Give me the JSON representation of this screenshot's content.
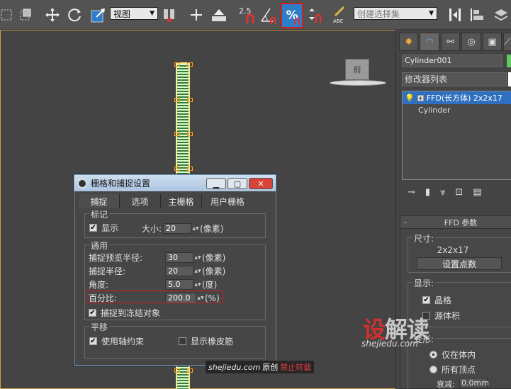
{
  "toolbar": {
    "view_dropdown": "视图",
    "snap_value": "2.5",
    "named_selection": "创建选择集"
  },
  "viewport": {
    "viewcube_label": "前"
  },
  "panel": {
    "object_name": "Cylinder001",
    "object_color": "#5ec95e",
    "modifier_list": "修改器列表",
    "stack": {
      "ffd": "FFD(长方体) 2x2x17",
      "cylinder": "Cylinder"
    },
    "ffd_params": {
      "title": "FFD 参数",
      "dimensions_group": "尺寸:",
      "dimensions_value": "2x2x17",
      "set_points_button": "设置点数",
      "display_group": "显示:",
      "lattice_label": "晶格",
      "source_volume_label": "源体积",
      "deform_group": "变形:",
      "inside_only_label": "仅在体内",
      "all_vertices_label": "所有顶点",
      "falloff_label": "衰减:",
      "falloff_value": "0.0mm"
    }
  },
  "dialog": {
    "title": "栅格和捕捉设置",
    "tabs": [
      "捕捉",
      "选项",
      "主栅格",
      "用户栅格"
    ],
    "marker": {
      "group": "标记",
      "display_label": "显示",
      "size_label": "大小:",
      "size_value": "20",
      "size_unit": "(像素)"
    },
    "general": {
      "group": "通用",
      "preview_radius_label": "捕捉预览半径:",
      "preview_radius_value": "30",
      "preview_radius_unit": "(像素)",
      "snap_radius_label": "捕捉半径:",
      "snap_radius_value": "20",
      "snap_radius_unit": "(像素)",
      "angle_label": "角度:",
      "angle_value": "5.0",
      "angle_unit": "(度)",
      "percent_label": "百分比:",
      "percent_value": "200.0",
      "percent_unit": "(%)",
      "frozen_label": "捕捉到冻结对象"
    },
    "translation": {
      "group": "平移",
      "axis_constraints_label": "使用轴约束",
      "rubber_band_label": "显示橡皮筋"
    }
  },
  "watermark": {
    "logo_a": "设",
    "logo_b": "解读",
    "url": "shejiedu.com",
    "bar_url": "shejiedu.com",
    "bar_original": "原创",
    "bar_forbid": "禁止转载"
  },
  "colors": {
    "accent_blue": "#2e7dc8",
    "highlight_red": "#d01f1f",
    "lattice_orange": "#ff9a1a"
  }
}
